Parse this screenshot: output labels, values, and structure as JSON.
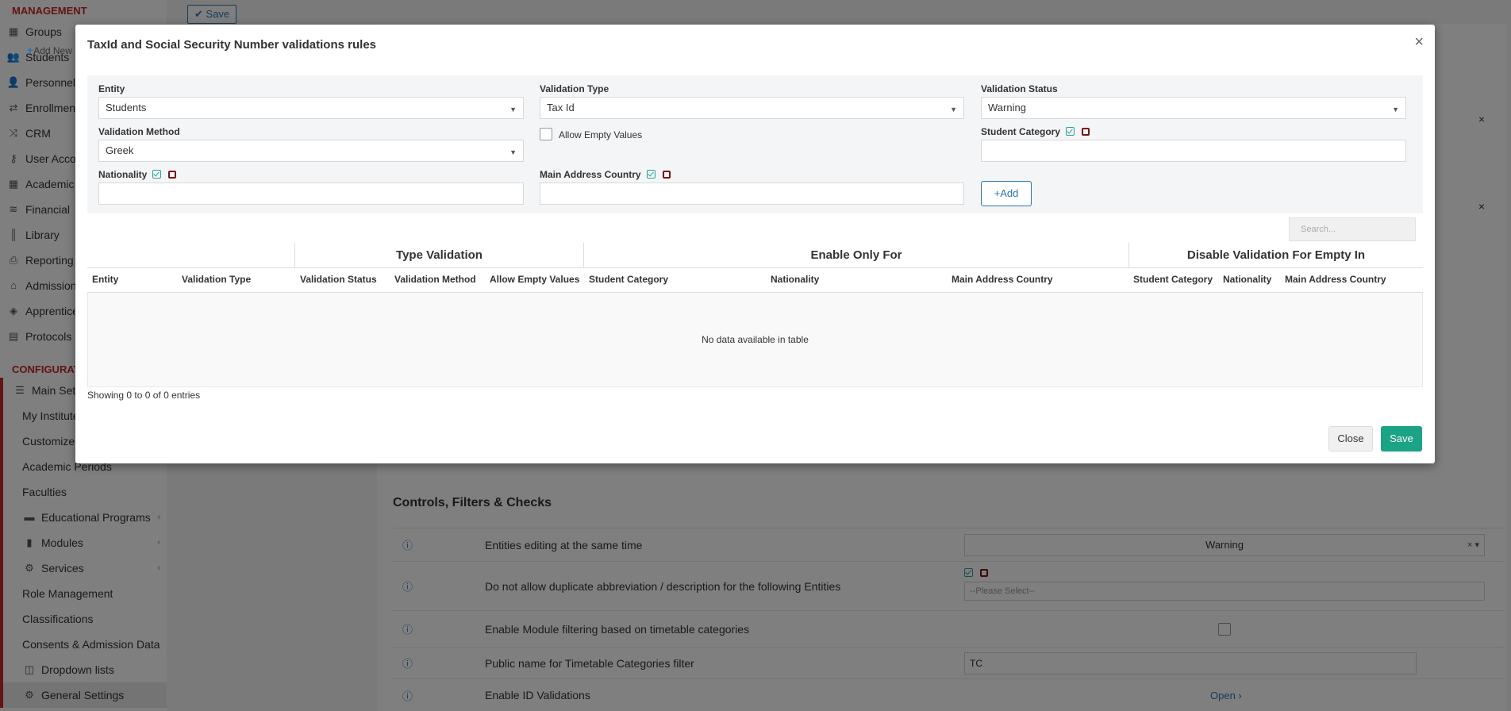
{
  "sidebar": {
    "management_title": "MANAGEMENT",
    "management_items": [
      {
        "label": "Groups",
        "icon": "groups-icon"
      },
      {
        "label": "Students",
        "icon": "students-icon"
      },
      {
        "label": "Personnel &",
        "icon": "personnel-icon"
      },
      {
        "label": "Enrollment",
        "icon": "enrollment-icon"
      },
      {
        "label": "CRM",
        "icon": "crm-icon"
      },
      {
        "label": "User Accou",
        "icon": "key-icon"
      },
      {
        "label": "Academic T",
        "icon": "academic-icon"
      },
      {
        "label": "Financial",
        "icon": "financial-icon"
      },
      {
        "label": "Library",
        "icon": "library-icon"
      },
      {
        "label": "Reporting",
        "icon": "printer-icon"
      },
      {
        "label": "Admission",
        "icon": "institution-icon"
      },
      {
        "label": "Apprentice",
        "icon": "cube-icon"
      },
      {
        "label": "Protocols",
        "icon": "protocols-icon"
      }
    ],
    "configuration_title": "CONFIGURATI",
    "main_settings": "Main Setti",
    "config_items": [
      {
        "label": "My Institute"
      },
      {
        "label": "Customize T"
      },
      {
        "label": "Academic Periods"
      },
      {
        "label": "Faculties"
      },
      {
        "label": "Educational Programs"
      },
      {
        "label": "Modules"
      },
      {
        "label": "Services"
      },
      {
        "label": "Role Management"
      },
      {
        "label": "Classifications"
      },
      {
        "label": "Consents & Admission Data"
      },
      {
        "label": "Dropdown lists"
      },
      {
        "label": "General Settings"
      }
    ]
  },
  "background": {
    "save_label": "Save",
    "section_title": "Controls, Filters & Checks",
    "rows": [
      {
        "label": "Entities editing at the same time",
        "value": "Warning"
      },
      {
        "label": "Do not allow duplicate abbreviation / description for the following Entities",
        "placeholder": "--Please Select--"
      },
      {
        "label": "Enable Module filtering based on timetable categories"
      },
      {
        "label": "Public name for Timetable Categories filter",
        "value": "TC"
      },
      {
        "label": "Enable ID Validations",
        "link": "Open"
      }
    ]
  },
  "modal": {
    "title": "TaxId and Social Security Number validations rules",
    "add_new": "Add New",
    "form": {
      "entity_label": "Entity",
      "entity_value": "Students",
      "validation_type_label": "Validation Type",
      "validation_type_value": "Tax Id",
      "validation_status_label": "Validation Status",
      "validation_status_value": "Warning",
      "validation_method_label": "Validation Method",
      "validation_method_value": "Greek",
      "allow_empty_label": "Allow Empty Values",
      "student_category_label": "Student Category",
      "nationality_label": "Nationality",
      "main_address_country_label": "Main Address Country",
      "add_button": "Add"
    },
    "search_placeholder": "Search...",
    "table": {
      "groups": [
        "Type Validation",
        "Enable Only For",
        "Disable Validation For Empty In"
      ],
      "columns": [
        "Entity",
        "Validation Type",
        "Validation Status",
        "Validation Method",
        "Allow Empty Values",
        "Student Category",
        "Nationality",
        "Main Address Country",
        "Student Category",
        "Nationality",
        "Main Address Country"
      ],
      "empty_text": "No data available in table"
    },
    "info": "Showing 0 to 0 of 0 entries",
    "close_button": "Close",
    "save_button": "Save"
  },
  "colors": {
    "accent": "#2a77b6",
    "save_green": "#1aa384",
    "brand_red": "#c62828"
  }
}
